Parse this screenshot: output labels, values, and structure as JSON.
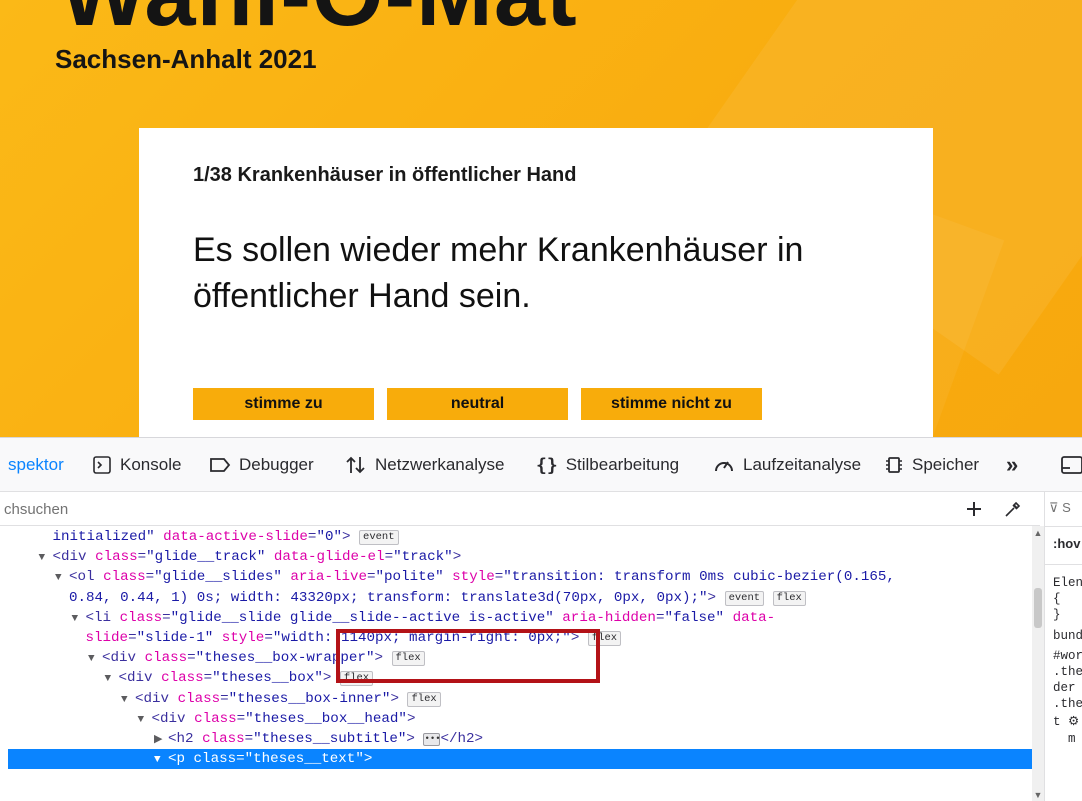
{
  "page": {
    "big_title": "Wahl-O-Mat",
    "region": "Sachsen-Anhalt 2021",
    "card": {
      "subtitle": "1/38 Krankenhäuser in öffentlicher Hand",
      "thesis": "Es sollen wieder mehr Krankenhäuser in öffentlicher Hand sein.",
      "buttons": [
        "stimme zu",
        "neutral",
        "stimme nicht zu"
      ]
    },
    "colors": {
      "background": "#fbb917",
      "button": "#f8ac0b",
      "card": "#ffffff"
    }
  },
  "devtools": {
    "tabs": [
      {
        "label": "spektor",
        "icon": "inspector-icon",
        "active": true
      },
      {
        "label": "Konsole",
        "icon": "console-icon"
      },
      {
        "label": "Debugger",
        "icon": "debugger-icon"
      },
      {
        "label": "Netzwerkanalyse",
        "icon": "network-icon"
      },
      {
        "label": "Stilbearbeitung",
        "icon": "style-editor-icon"
      },
      {
        "label": "Laufzeitanalyse",
        "icon": "performance-icon"
      },
      {
        "label": "Speicher",
        "icon": "memory-icon"
      }
    ],
    "overflow_label": "»",
    "search_placeholder": "chsuchen",
    "markup_lines": [
      {
        "indent": 1,
        "twisty": "",
        "parts": [
          [
            "av",
            "initialized\""
          ],
          [
            "an",
            " data-active-slide"
          ],
          [
            "tag",
            "="
          ],
          [
            "av",
            "\"0\""
          ],
          [
            "tag",
            ">"
          ]
        ],
        "badges": [
          "event"
        ]
      },
      {
        "indent": 1,
        "twisty": "▼",
        "parts": [
          [
            "tag",
            "<div "
          ],
          [
            "an",
            "class"
          ],
          [
            "tag",
            "="
          ],
          [
            "av",
            "\"glide__track\""
          ],
          [
            "an",
            " data-glide-el"
          ],
          [
            "tag",
            "="
          ],
          [
            "av",
            "\"track\""
          ],
          [
            "tag",
            ">"
          ]
        ],
        "badges": []
      },
      {
        "indent": 2,
        "twisty": "▼",
        "parts": [
          [
            "tag",
            "<ol "
          ],
          [
            "an",
            "class"
          ],
          [
            "tag",
            "="
          ],
          [
            "av",
            "\"glide__slides\""
          ],
          [
            "an",
            " aria-live"
          ],
          [
            "tag",
            "="
          ],
          [
            "av",
            "\"polite\""
          ],
          [
            "an",
            " style"
          ],
          [
            "tag",
            "="
          ],
          [
            "av",
            "\"transition: transform 0ms cubic-bezier(0.165,"
          ]
        ],
        "badges": []
      },
      {
        "indent": 2,
        "twisty": "",
        "parts": [
          [
            "av",
            "0.84, 0.44, 1) 0s; width: 43320px; transform: translate3d(70px, 0px, 0px);\""
          ],
          [
            "tag",
            ">"
          ]
        ],
        "badges": [
          "event",
          "flex"
        ]
      },
      {
        "indent": 3,
        "twisty": "▼",
        "parts": [
          [
            "tag",
            "<li "
          ],
          [
            "an",
            "class"
          ],
          [
            "tag",
            "="
          ],
          [
            "av",
            "\"glide__slide glide__slide--active is-active\""
          ],
          [
            "an",
            " aria-hidden"
          ],
          [
            "tag",
            "="
          ],
          [
            "av",
            "\"false\""
          ],
          [
            "an",
            " data-"
          ]
        ],
        "badges": []
      },
      {
        "indent": 3,
        "twisty": "",
        "parts": [
          [
            "an",
            "slide"
          ],
          [
            "tag",
            "="
          ],
          [
            "av",
            "\"slide-1\""
          ],
          [
            "an",
            " style"
          ],
          [
            "tag",
            "="
          ],
          [
            "av",
            "\"width: 1140px; margin-right: 0px;\""
          ],
          [
            "tag",
            ">"
          ]
        ],
        "badges": [
          "flex"
        ]
      },
      {
        "indent": 4,
        "twisty": "▼",
        "parts": [
          [
            "tag",
            "<div "
          ],
          [
            "an",
            "class"
          ],
          [
            "tag",
            "="
          ],
          [
            "av",
            "\"theses__box-wrapper\""
          ],
          [
            "tag",
            ">"
          ]
        ],
        "badges": [
          "flex"
        ]
      },
      {
        "indent": 5,
        "twisty": "▼",
        "parts": [
          [
            "tag",
            "<div "
          ],
          [
            "an",
            "class"
          ],
          [
            "tag",
            "="
          ],
          [
            "av",
            "\"theses__box\""
          ],
          [
            "tag",
            ">"
          ]
        ],
        "badges": [
          "flex"
        ]
      },
      {
        "indent": 6,
        "twisty": "▼",
        "parts": [
          [
            "tag",
            "<div "
          ],
          [
            "an",
            "class"
          ],
          [
            "tag",
            "="
          ],
          [
            "av",
            "\"theses__box-inner\""
          ],
          [
            "tag",
            ">"
          ]
        ],
        "badges": [
          "flex"
        ]
      },
      {
        "indent": 7,
        "twisty": "▼",
        "parts": [
          [
            "tag",
            "<div "
          ],
          [
            "an",
            "class"
          ],
          [
            "tag",
            "="
          ],
          [
            "av",
            "\"theses__box__head\""
          ],
          [
            "tag",
            ">"
          ]
        ],
        "badges": []
      },
      {
        "indent": 8,
        "twisty": "▶",
        "parts": [
          [
            "tag",
            "<h2 "
          ],
          [
            "an",
            "class"
          ],
          [
            "tag",
            "="
          ],
          [
            "av",
            "\"theses__subtitle\""
          ],
          [
            "tag",
            ">"
          ]
        ],
        "badges": [
          "…"
        ],
        "after": "</h2>"
      },
      {
        "indent": 8,
        "twisty": "▼",
        "parts": [
          [
            "tag",
            "<p "
          ],
          [
            "an",
            "class"
          ],
          [
            "tag",
            "="
          ],
          [
            "av",
            "\"theses__text\""
          ],
          [
            "tag",
            ">"
          ]
        ],
        "badges": [],
        "selected": true
      }
    ],
    "rules_panel": {
      "filter": "S",
      "pseudo": ":hov",
      "lines": [
        "Elen",
        "{",
        "}",
        "bund",
        "#wor",
        ".the",
        "der ",
        ".the",
        "t ⚙",
        "  m"
      ]
    }
  }
}
